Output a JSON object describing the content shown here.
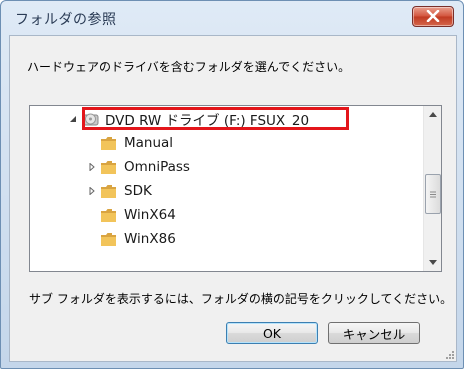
{
  "window": {
    "title": "フォルダの参照"
  },
  "instruction": "ハードウェアのドライバを含むフォルダを選んでください。",
  "tree": {
    "root": {
      "label": "DVD RW ドライブ (F:) FSUX_20",
      "icon": "dvd-drive-icon",
      "expanded": true,
      "highlighted": true
    },
    "children": [
      {
        "label": "Manual",
        "icon": "folder-icon",
        "has_children": false
      },
      {
        "label": "OmniPass",
        "icon": "folder-icon",
        "has_children": true
      },
      {
        "label": "SDK",
        "icon": "folder-icon",
        "has_children": true
      },
      {
        "label": "WinX64",
        "icon": "folder-icon",
        "has_children": false
      },
      {
        "label": "WinX86",
        "icon": "folder-icon",
        "has_children": false
      }
    ]
  },
  "hint": "サブ フォルダを表示するには、フォルダの横の記号をクリックしてください。",
  "buttons": {
    "ok": "OK",
    "cancel": "キャンセル"
  },
  "colors": {
    "highlight_border": "#e3161b",
    "close_button": "#c94b35"
  }
}
